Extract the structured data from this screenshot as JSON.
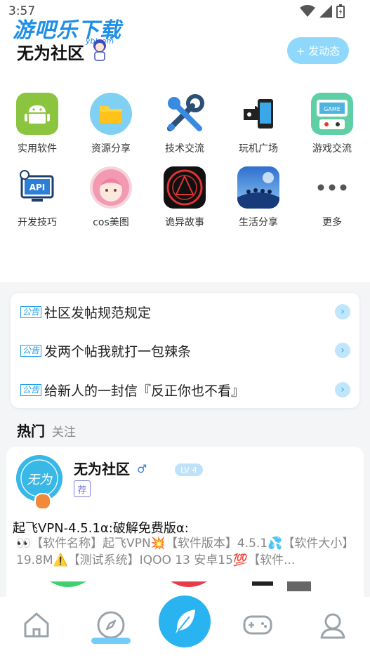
{
  "status_bar": {
    "time": "3:57"
  },
  "watermark": {
    "text": "游吧乐下载",
    "sub": "yblcom"
  },
  "header": {
    "title": "无为社区",
    "post_button": "+ 发动态"
  },
  "categories": [
    {
      "label": "实用软件",
      "icon": "android-icon"
    },
    {
      "label": "资源分享",
      "icon": "folder-icon"
    },
    {
      "label": "技术交流",
      "icon": "tools-icon"
    },
    {
      "label": "玩机广场",
      "icon": "phone-puzzle-icon"
    },
    {
      "label": "游戏交流",
      "icon": "game-console-icon"
    },
    {
      "label": "开发技巧",
      "icon": "api-icon"
    },
    {
      "label": "cos美图",
      "icon": "anime-girl-icon"
    },
    {
      "label": "诡异故事",
      "icon": "occult-seal-icon"
    },
    {
      "label": "生活分享",
      "icon": "friends-sky-icon"
    },
    {
      "label": "更多",
      "icon": "more-dots-icon"
    }
  ],
  "notices": {
    "tag": "公告",
    "items": [
      "社区发帖规范规定",
      "发两个帖我就打一包辣条",
      "给新人的一封信『反正你也不看』"
    ]
  },
  "feed_tabs": {
    "active": "热门",
    "other": "关注"
  },
  "post": {
    "author": "无为社区",
    "avatar_text": "无为",
    "gender_symbol": "♂",
    "level_label": "LV",
    "level": "4",
    "recommend_tag": "荐",
    "title": "起飞VPN-4.5.1α:破解免费版α:",
    "body": "👀【软件名称】起飞VPN💥【软件版本】4.5.1💦【软件大小】19.8M⚠️【测试系统】IQOO 13 安卓15💯【软件..."
  },
  "colors": {
    "accent": "#29b3f0",
    "post_button": "#8fd8fb",
    "notice_tag": "#1e9be8"
  }
}
